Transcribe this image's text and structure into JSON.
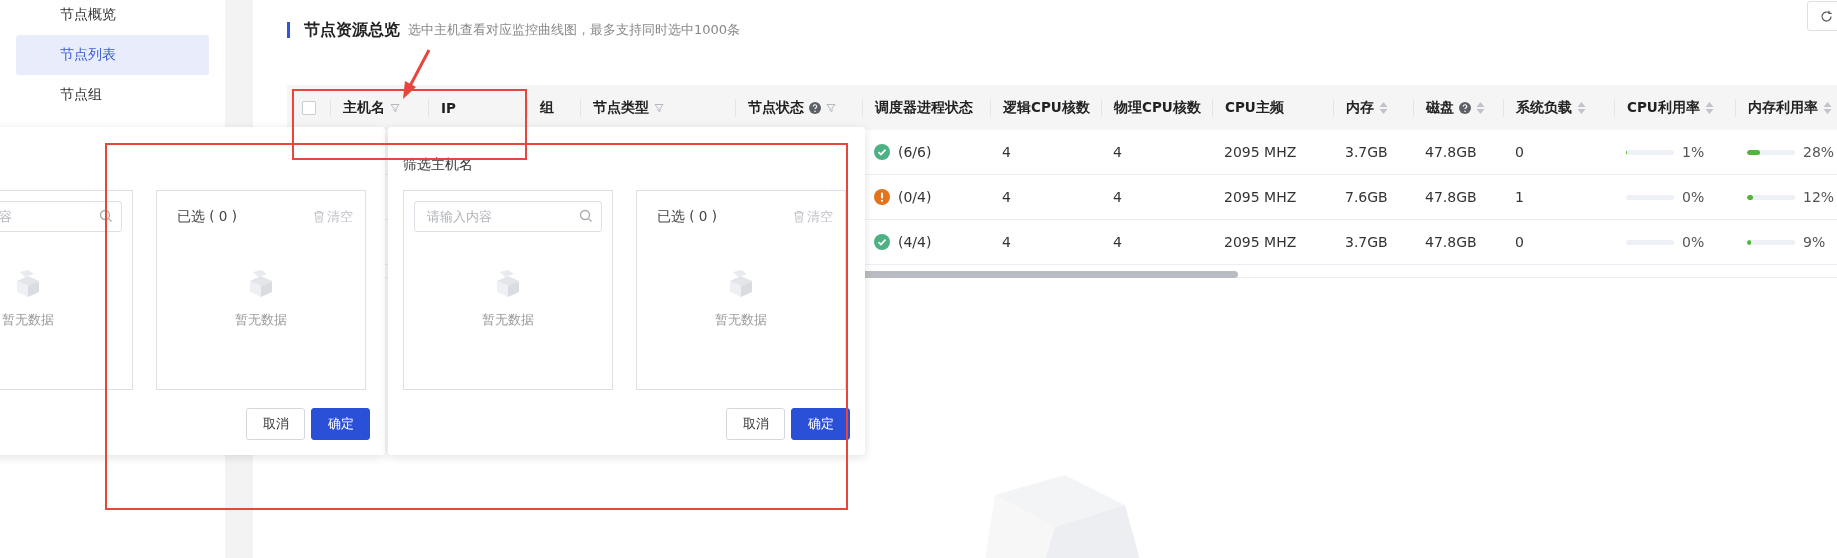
{
  "sidebar": {
    "items": [
      {
        "label": "节点概览",
        "selected": false
      },
      {
        "label": "节点列表",
        "selected": true
      },
      {
        "label": "节点组",
        "selected": false
      }
    ]
  },
  "section": {
    "title": "节点资源总览",
    "hint": "选中主机查看对应监控曲线图，最多支持同时选中1000条"
  },
  "table": {
    "select_all": {
      "checked": false
    },
    "columns": [
      {
        "label": "主机名",
        "filter": true,
        "sort": false,
        "help": false
      },
      {
        "label": "IP",
        "filter": false,
        "sort": false,
        "help": false
      },
      {
        "label": "组",
        "filter": false,
        "sort": false,
        "help": false
      },
      {
        "label": "节点类型",
        "filter": true,
        "sort": false,
        "help": false
      },
      {
        "label": "节点状态",
        "filter": true,
        "sort": false,
        "help": true
      },
      {
        "label": "调度器进程状态",
        "filter": false,
        "sort": false,
        "help": false
      },
      {
        "label": "逻辑CPU核数",
        "filter": false,
        "sort": false,
        "help": false
      },
      {
        "label": "物理CPU核数",
        "filter": false,
        "sort": false,
        "help": false
      },
      {
        "label": "CPU主频",
        "filter": false,
        "sort": false,
        "help": false
      },
      {
        "label": "内存",
        "filter": false,
        "sort": true,
        "help": false
      },
      {
        "label": "磁盘",
        "filter": false,
        "sort": true,
        "help": true
      },
      {
        "label": "系统负载",
        "filter": false,
        "sort": true,
        "help": false
      },
      {
        "label": "CPU利用率",
        "filter": false,
        "sort": true,
        "help": false
      },
      {
        "label": "内存利用率",
        "filter": false,
        "sort": true,
        "help": false
      }
    ],
    "rows": [
      {
        "kind": "ok",
        "scheduler": "(6/6)",
        "logical_cpu": "4",
        "physical_cpu": "4",
        "cpu_freq": "2095 MHZ",
        "memory": "3.7GB",
        "disk": "47.8GB",
        "load": "0",
        "cpu_usage": {
          "level": 0.01,
          "reading": "1%"
        },
        "mem_usage": {
          "level": 0.28,
          "reading": "28%"
        }
      },
      {
        "kind": "warning",
        "scheduler": "(0/4)",
        "logical_cpu": "4",
        "physical_cpu": "4",
        "cpu_freq": "2095 MHZ",
        "memory": "7.6GB",
        "disk": "47.8GB",
        "load": "1",
        "cpu_usage": {
          "level": 0,
          "reading": "0%"
        },
        "mem_usage": {
          "level": 0.12,
          "reading": "12%"
        }
      },
      {
        "kind": "ok",
        "scheduler": "(4/4)",
        "logical_cpu": "4",
        "physical_cpu": "4",
        "cpu_freq": "2095 MHZ",
        "memory": "3.7GB",
        "disk": "47.8GB",
        "load": "0",
        "cpu_usage": {
          "level": 0,
          "reading": "0%"
        },
        "mem_usage": {
          "level": 0.09,
          "reading": "9%"
        }
      }
    ]
  },
  "popovers": [
    {
      "search": {
        "placeholder": "容"
      },
      "empty_left": "暂无数据",
      "selected_label": "已选 ( 0 )",
      "clear": "清空",
      "empty_right": "暂无数据",
      "buttons": [
        "取消",
        "确定"
      ]
    },
    {
      "title": "筛选主机名",
      "search": {
        "placeholder": "请输入内容"
      },
      "empty_left": "暂无数据",
      "selected_label": "已选 ( 0 )",
      "clear": "清空",
      "empty_right": "暂无数据",
      "buttons": [
        "取消",
        "确定"
      ]
    }
  ]
}
